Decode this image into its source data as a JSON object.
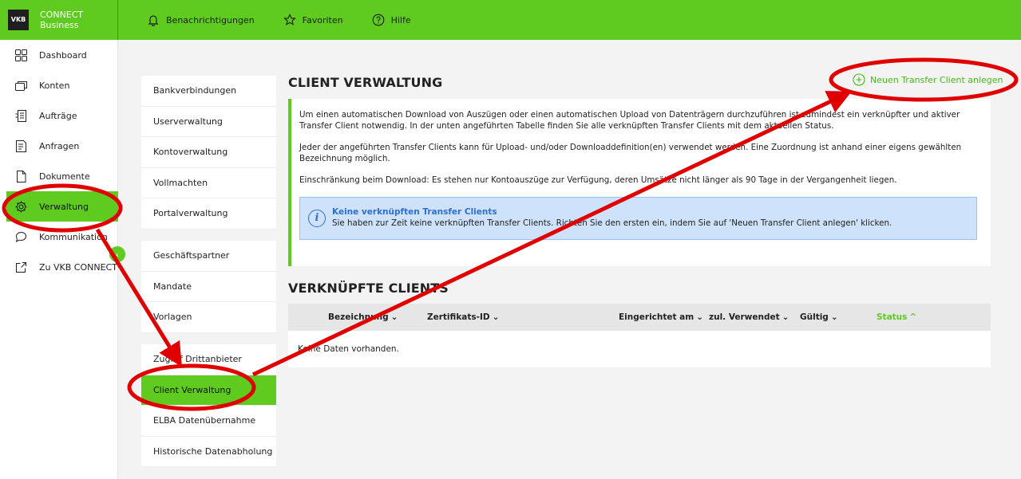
{
  "brand": {
    "logo_text": "VKB",
    "line1": "CONNECT",
    "line2": "Business"
  },
  "topnav": [
    {
      "label": "Benachrichtigungen",
      "icon": "bell-icon"
    },
    {
      "label": "Favoriten",
      "icon": "star-icon"
    },
    {
      "label": "Hilfe",
      "icon": "help-icon"
    }
  ],
  "sidebar": [
    {
      "label": "Dashboard",
      "icon": "dashboard-icon"
    },
    {
      "label": "Konten",
      "icon": "accounts-icon"
    },
    {
      "label": "Aufträge",
      "icon": "orders-icon"
    },
    {
      "label": "Anfragen",
      "icon": "requests-icon"
    },
    {
      "label": "Dokumente",
      "icon": "documents-icon"
    },
    {
      "label": "Verwaltung",
      "icon": "gear-icon",
      "active": true
    },
    {
      "label": "Kommunikation",
      "icon": "chat-icon"
    },
    {
      "label": "Zu VKB CONNECT",
      "icon": "external-link-icon"
    }
  ],
  "collapse_label": "‹",
  "subnav_groups": [
    [
      "Bankverbindungen",
      "Userverwaltung",
      "Kontoverwaltung",
      "Vollmachten",
      "Portalverwaltung"
    ],
    [
      "Geschäftspartner",
      "Mandate",
      "Vorlagen"
    ],
    [
      "Zugriff Drittanbieter",
      "Client Verwaltung",
      "ELBA Datenübernahme",
      "Historische Datenabholung"
    ]
  ],
  "subnav_active": "Client Verwaltung",
  "page": {
    "title": "CLIENT VERWALTUNG",
    "new_client_label": "Neuen Transfer Client anlegen",
    "paragraphs": [
      "Um einen automatischen Download von Auszügen oder einen automatischen Upload von Datenträgern durchzuführen ist zumindest ein verknüpfter und aktiver Transfer Client notwendig. In der unten angeführten Tabelle finden Sie alle verknüpften Transfer Clients mit dem aktuellen Status.",
      "Jeder der angeführten Transfer Clients kann für Upload- und/oder Downloaddefinition(en) verwendet werden. Eine Zuordnung ist anhand einer eigens gewählten Bezeichnung möglich.",
      "Einschränkung beim Download: Es stehen nur Kontoauszüge zur Verfügung, deren Umsätze nicht länger als 90 Tage in der Vergangenheit liegen."
    ],
    "notice": {
      "icon": "info-icon",
      "icon_glyph": "i",
      "title": "Keine verknüpften Transfer Clients",
      "text": "Sie haben zur Zeit keine verknüpften Transfer Clients. Richten Sie den ersten ein, indem Sie auf 'Neuen Transfer Client anlegen' klicken."
    },
    "clients_title": "VERKNÜPFTE CLIENTS",
    "table": {
      "columns": [
        "Bezeichnung",
        "Zertifikats-ID",
        "Eingerichtet am",
        "zul. Verwendet",
        "Gültig",
        "Status"
      ],
      "sort_down": "⌄",
      "sort_up": "^",
      "empty_text": "Keine Daten vorhanden."
    }
  },
  "colors": {
    "accent": "#5ecb1e",
    "annotation": "#e00000",
    "info_blue": "#2d6fd4"
  }
}
